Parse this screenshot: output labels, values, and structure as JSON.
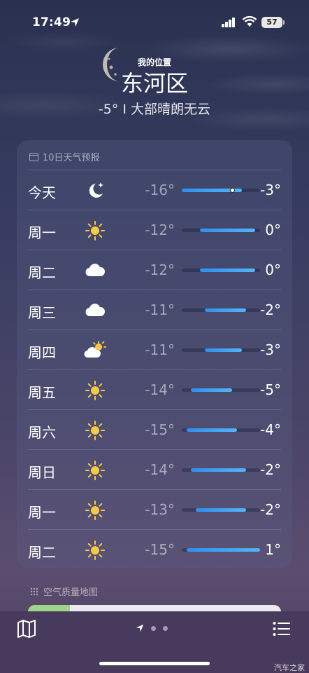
{
  "status": {
    "time": "17:49",
    "battery": "57"
  },
  "header": {
    "location_label": "我的位置",
    "city": "东河区",
    "condition": "-5° I 大部晴朗无云"
  },
  "forecast": {
    "title": "10日天气预报",
    "range_min": -16,
    "range_max": 1,
    "days": [
      {
        "day": "今天",
        "icon": "moon-stars-icon",
        "low": "-16°",
        "high": "-3°",
        "low_val": -16,
        "high_val": -3,
        "current_val": -5
      },
      {
        "day": "周一",
        "icon": "sun-icon",
        "low": "-12°",
        "high": "0°",
        "low_val": -12,
        "high_val": 0
      },
      {
        "day": "周二",
        "icon": "cloud-icon",
        "low": "-12°",
        "high": "0°",
        "low_val": -12,
        "high_val": 0
      },
      {
        "day": "周三",
        "icon": "cloud-icon",
        "low": "-11°",
        "high": "-2°",
        "low_val": -11,
        "high_val": -2
      },
      {
        "day": "周四",
        "icon": "partly-cloudy-icon",
        "low": "-11°",
        "high": "-3°",
        "low_val": -11,
        "high_val": -3
      },
      {
        "day": "周五",
        "icon": "sun-icon",
        "low": "-14°",
        "high": "-5°",
        "low_val": -14,
        "high_val": -5
      },
      {
        "day": "周六",
        "icon": "sun-icon",
        "low": "-15°",
        "high": "-4°",
        "low_val": -15,
        "high_val": -4
      },
      {
        "day": "周日",
        "icon": "sun-icon",
        "low": "-14°",
        "high": "-2°",
        "low_val": -14,
        "high_val": -2
      },
      {
        "day": "周一",
        "icon": "sun-icon",
        "low": "-13°",
        "high": "-2°",
        "low_val": -13,
        "high_val": -2
      },
      {
        "day": "周二",
        "icon": "sun-icon",
        "low": "-15°",
        "high": "1°",
        "low_val": -15,
        "high_val": 1
      }
    ]
  },
  "air_quality": {
    "title": "空气质量地图"
  },
  "watermark": "汽车之家"
}
